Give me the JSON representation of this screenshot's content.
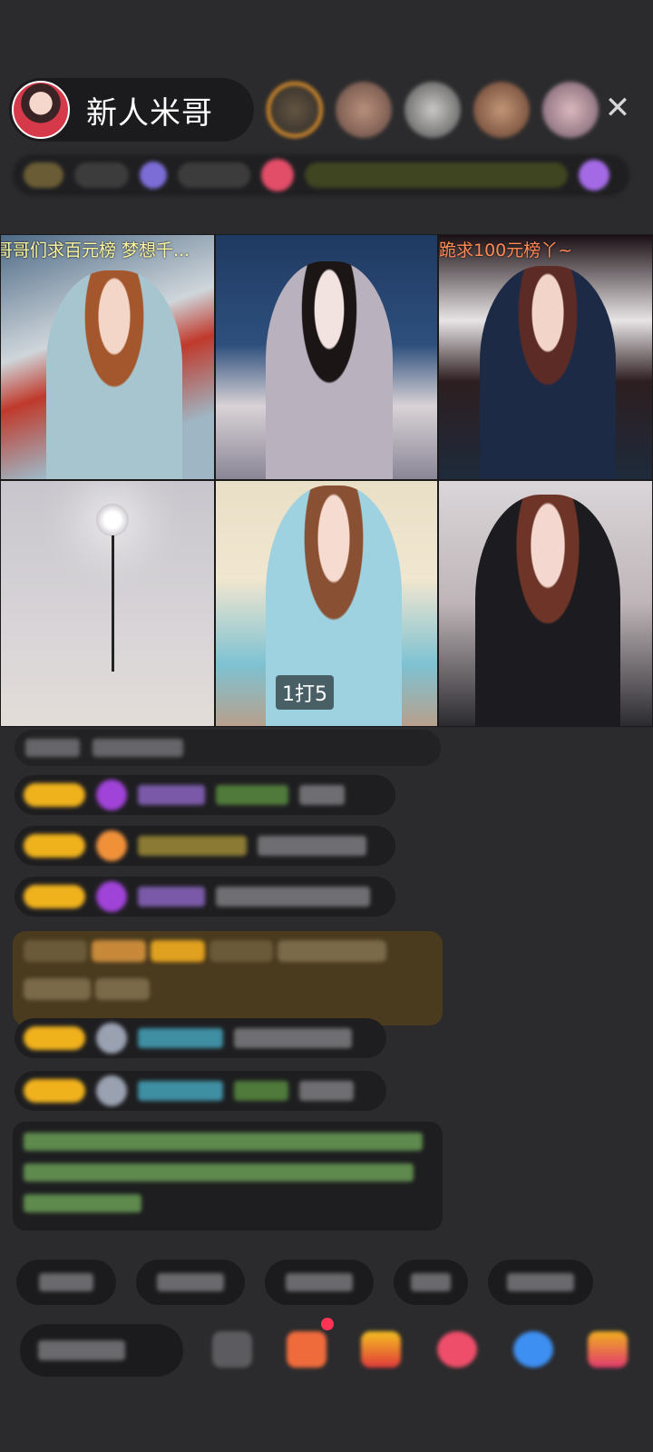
{
  "header": {
    "host_name": "新人米哥",
    "close_symbol": "✕"
  },
  "video_grid": {
    "tiles": [
      {
        "caption": "哥哥们求百元榜  梦想千..."
      },
      {
        "caption": ""
      },
      {
        "caption": "跪求100元榜丫~"
      },
      {
        "caption": ""
      },
      {
        "caption": "",
        "score_badge": "1打5"
      },
      {
        "caption": ""
      }
    ]
  },
  "colors": {
    "background": "#2b2b2d",
    "caption_yellow": "#fdf7a0",
    "caption_orange": "#ff8a55",
    "badge_gold": "#f0b21c"
  },
  "icons": [
    "close-icon",
    "gift-icon",
    "message-icon",
    "share-icon",
    "more-icon"
  ]
}
